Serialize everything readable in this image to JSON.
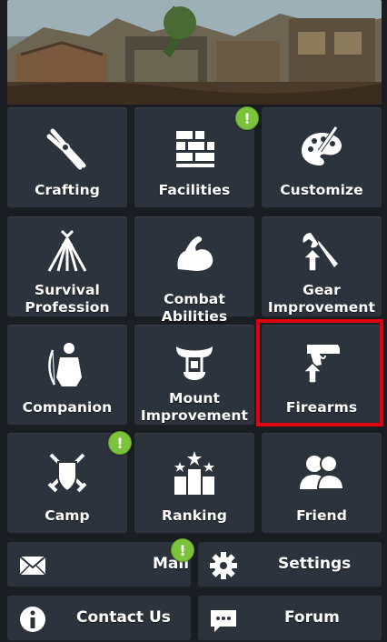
{
  "tiles": [
    {
      "key": "crafting",
      "label": "Crafting",
      "icon": "pliers-icon"
    },
    {
      "key": "facilities",
      "label": "Facilities",
      "icon": "bricks-icon",
      "badge": "!"
    },
    {
      "key": "customize",
      "label": "Customize",
      "icon": "palette-icon"
    },
    {
      "key": "survival_profession",
      "label": "Survival\nProfession",
      "icon": "tent-icon"
    },
    {
      "key": "combat_abilities",
      "label": "Combat Abilities",
      "icon": "flexed-arm-icon"
    },
    {
      "key": "gear_improvement",
      "label": "Gear\nImprovement",
      "icon": "wrench-upgrade-icon"
    },
    {
      "key": "companion",
      "label": "Companion",
      "icon": "archer-icon"
    },
    {
      "key": "mount_improvement",
      "label": "Mount\nImprovement",
      "icon": "saddle-icon"
    },
    {
      "key": "firearms",
      "label": "Firearms",
      "icon": "pistol-upgrade-icon"
    },
    {
      "key": "camp",
      "label": "Camp",
      "icon": "crossed-swords-shield-icon",
      "badge": "!"
    },
    {
      "key": "ranking",
      "label": "Ranking",
      "icon": "podium-icon"
    },
    {
      "key": "friend",
      "label": "Friend",
      "icon": "people-icon"
    }
  ],
  "buttons": {
    "mail": {
      "label": "Mail",
      "icon": "envelope-icon",
      "badge": "!"
    },
    "settings": {
      "label": "Settings",
      "icon": "gear-icon"
    },
    "contact_us": {
      "label": "Contact Us",
      "icon": "info-icon"
    },
    "forum": {
      "label": "Forum",
      "icon": "chat-icon"
    }
  },
  "colors": {
    "tile_bg": "#2d333c",
    "page_bg": "#1a1d21",
    "badge": "#7cc23b",
    "highlight": "#e0000f"
  }
}
